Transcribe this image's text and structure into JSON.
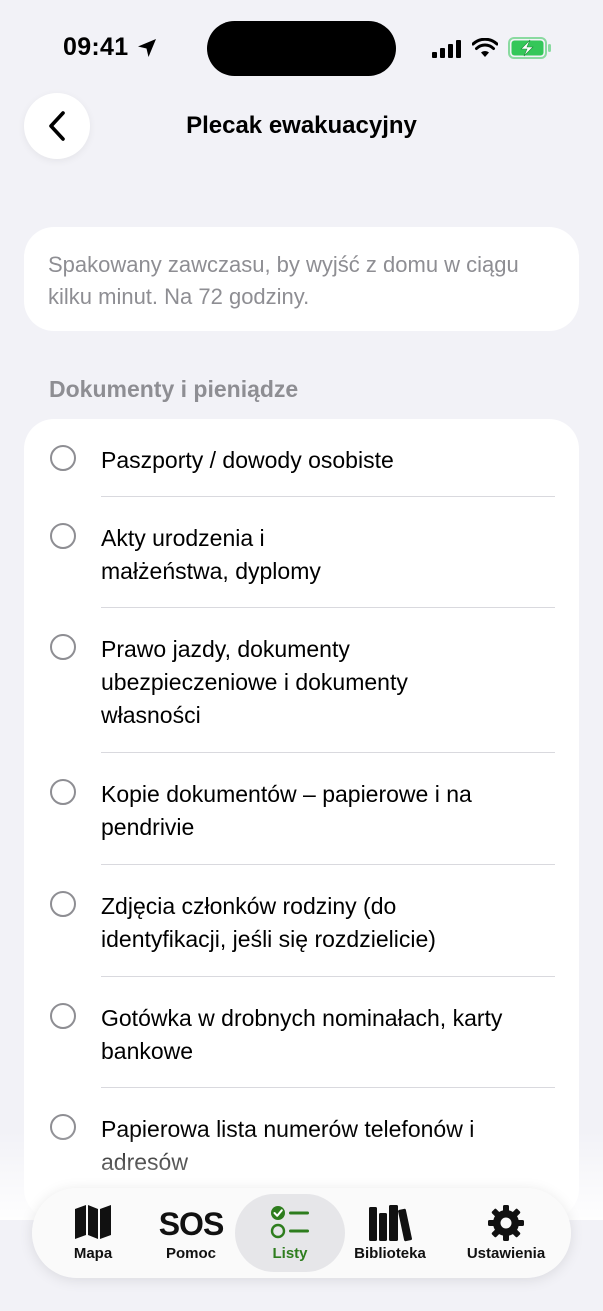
{
  "status": {
    "time": "09:41"
  },
  "header": {
    "title": "Plecak ewakuacyjny"
  },
  "description": {
    "text": "Spakowany zawczasu, by wyjść z domu w ciągu kilku minut. Na 72 godziny."
  },
  "section": {
    "title": "Dokumenty i pieniądze"
  },
  "items": [
    {
      "label": "Paszporty / dowody osobiste",
      "checked": false
    },
    {
      "label": "Akty urodzenia i małżeństwa, dyplomy",
      "checked": false
    },
    {
      "label": "Prawo jazdy, dokumenty ubezpieczeniowe i dokumenty własności",
      "checked": false
    },
    {
      "label": "Kopie dokumentów – papierowe i na pendrivie",
      "checked": false
    },
    {
      "label": "Zdjęcia członków rodziny (do identyfikacji, jeśli się rozdzielicie)",
      "checked": false
    },
    {
      "label": "Gotówka w drobnych nominałach, karty bankowe",
      "checked": false
    },
    {
      "label": "Papierowa lista numerów telefonów i adresów",
      "checked": false
    }
  ],
  "tabs": [
    {
      "label": "Mapa",
      "icon": "map-icon",
      "active": false
    },
    {
      "label": "Pomoc",
      "icon": "sos-icon",
      "icon_text": "SOS",
      "active": false
    },
    {
      "label": "Listy",
      "icon": "checklist-icon",
      "active": true
    },
    {
      "label": "Biblioteka",
      "icon": "books-icon",
      "active": false
    },
    {
      "label": "Ustawienia",
      "icon": "gear-icon",
      "active": false
    }
  ],
  "colors": {
    "accent": "#2e7d1e",
    "battery": "#34c759",
    "secondary_text": "#8e8e93",
    "background": "#f2f2f7"
  }
}
